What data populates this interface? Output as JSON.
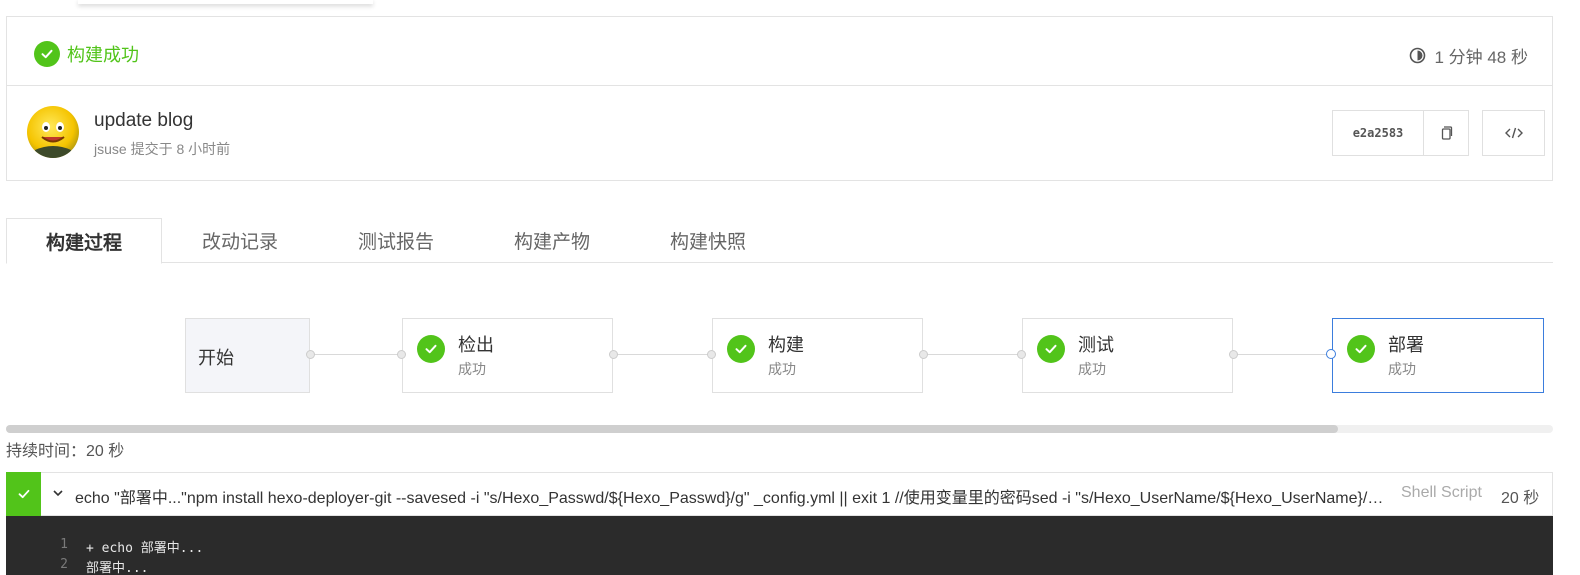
{
  "status": {
    "label": "构建成功",
    "duration": "1 分钟 48 秒",
    "color": "#52c41a"
  },
  "commit": {
    "message": "update blog",
    "meta": "jsuse 提交于 8 小时前",
    "hash": "e2a2583",
    "avatar_icon": "smiley-avatar"
  },
  "tabs": [
    {
      "label": "构建过程",
      "active": true
    },
    {
      "label": "改动记录",
      "active": false
    },
    {
      "label": "测试报告",
      "active": false
    },
    {
      "label": "构建产物",
      "active": false
    },
    {
      "label": "构建快照",
      "active": false
    }
  ],
  "pipeline": {
    "start": {
      "label": "开始"
    },
    "stages": [
      {
        "name": "检出",
        "status": "成功"
      },
      {
        "name": "构建",
        "status": "成功"
      },
      {
        "name": "测试",
        "status": "成功"
      },
      {
        "name": "部署",
        "status": "成功",
        "selected": true
      }
    ]
  },
  "persist": "持续时间：20 秒",
  "step": {
    "command": "echo \"部署中...\"npm install hexo-deployer-git --savesed -i \"s/Hexo_Passwd/${Hexo_Passwd}/g\" _config.yml || exit 1 //使用变量里的密码sed -i \"s/Hexo_UserName/${Hexo_UserName}/g\" _config.yml",
    "type": "Shell Script",
    "time": "20 秒"
  },
  "log": [
    {
      "num": "1",
      "text": "+ echo 部署中..."
    },
    {
      "num": "2",
      "text": "部署中..."
    }
  ]
}
